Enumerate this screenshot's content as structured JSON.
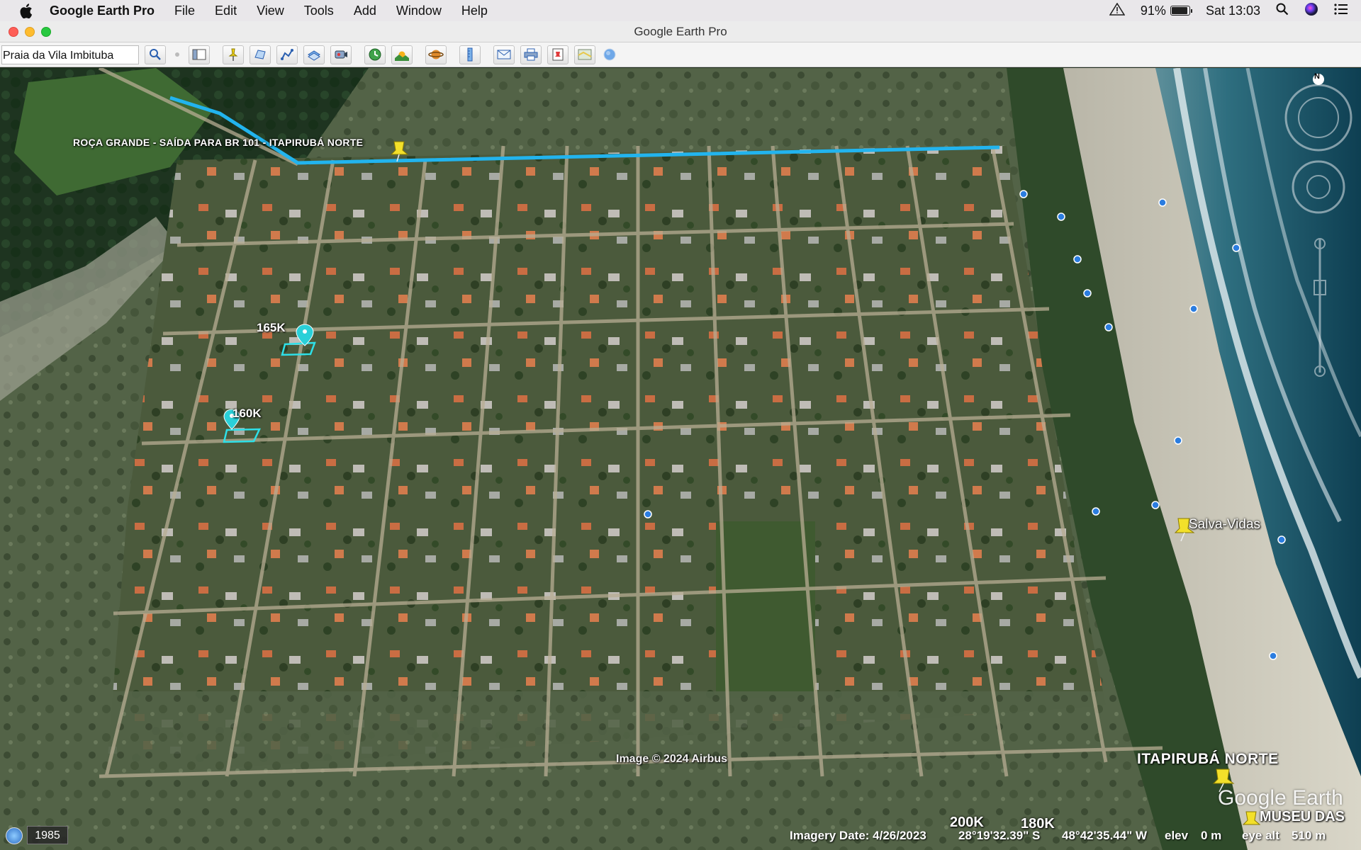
{
  "menubar": {
    "app_name": "Google Earth Pro",
    "items": [
      "File",
      "Edit",
      "View",
      "Tools",
      "Add",
      "Window",
      "Help"
    ],
    "battery": "91%",
    "battery_level": 0.91,
    "clock": "Sat 13:03"
  },
  "window": {
    "title": "Google Earth Pro"
  },
  "search": {
    "value": "Praia da Vila Imbituba"
  },
  "map": {
    "labels": {
      "road": "ROÇA GRANDE - SAÍDA PARA BR 101 - ITAPIRUBÁ NORTE",
      "lot_165": "165K",
      "lot_160": "160K",
      "salva_vidas": "Salva-Vidas",
      "itapiruba": "ITAPIRUBÁ NORTE",
      "museu": "MUSEU DAS",
      "lot_200": "200K",
      "lot_180": "180K"
    },
    "copyright": "Image © 2024 Airbus",
    "logo": "Google Earth",
    "compass_north": "N",
    "colors": {
      "path": "#22b4ee",
      "lot_outline": "#2ee0e8",
      "pin_yellow": "#f3e02a",
      "pin_cyan": "#2ad0d8"
    }
  },
  "status": {
    "year": "1985",
    "imagery_date": "Imagery Date: 4/26/2023",
    "lat": "28°19'32.39\" S",
    "lon": "48°42'35.44\" W",
    "elev_label": "elev",
    "elev_value": "0 m",
    "eye_alt_label": "eye alt",
    "eye_alt_value": "510 m"
  }
}
